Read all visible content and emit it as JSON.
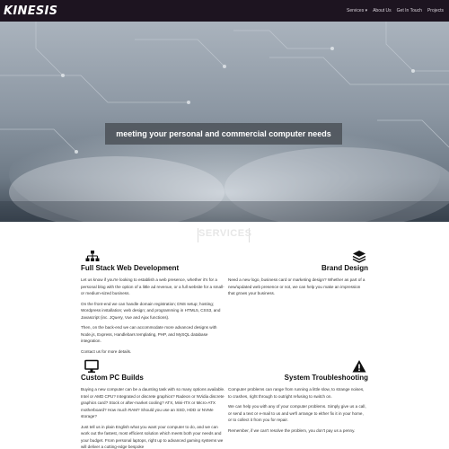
{
  "nav": {
    "brand": "KINESIS",
    "links": [
      "Services ▾",
      "About Us",
      "Get In Touch",
      "Projects"
    ]
  },
  "hero": {
    "caption": "meeting your personal and commercial computer needs"
  },
  "services": {
    "title": "SERVICES",
    "items": [
      {
        "icon": "sitemap-icon",
        "heading": "Full Stack Web Development",
        "paragraphs": [
          "Let us know if you're looking to establish a web presence, whether it's for a personal blog with the option of a little ad revenue, or a full website for a small- or medium-sized business.",
          "On the front-end we can handle domain registration; DNS setup; hosting; Wordpress installation; web design; and programming in HTML5, CSS3, and Javascript (inc. JQuery, Vue and Ajax functions).",
          "Then, on the back-end we can accommodate more advanced designs with Node.js, Express, Handlebars templating, PHP, and MySQL database integration.",
          "Contact us for more details."
        ]
      },
      {
        "icon": "layers-icon",
        "heading": "Brand Design",
        "paragraphs": [
          "Need a new logo, business card or marketing design? Whether as part of a new/updated web presence or not, we can help you make an impression that grows your business."
        ]
      },
      {
        "icon": "monitor-icon",
        "heading": "Custom PC Builds",
        "paragraphs": [
          "Buying a new computer can be a daunting task with so many options available. Intel or AMD CPU? Integrated or discrete graphics? Radeon or NVidia discrete graphics card? Stock or after-market cooling? ATX, Mini-ITX or Micro-ATX motherboard? How much RAM? Should you use an SSD, HDD or NVMe storage?",
          "Just tell us in plain English what you want your computer to do, and we can work out the fastest, most efficient solution which meets both your needs and your budget. From personal laptops, right up to advanced gaming systems we will deliver a cutting-edge bespoke"
        ]
      },
      {
        "icon": "warning-icon",
        "heading": "System Troubleshooting",
        "paragraphs": [
          "Computer problems can range from running a little slow, to strange noises, to crashes, right through to outright refusing to switch on.",
          "We can help you with any of your computer problems. Simply give us a call, or send a text or e-mail to us and we'll arrange to either fix it in your home, or to collect it from you for repair.",
          "Remember, if we can't resolve the problem, you don't pay us a penny."
        ]
      }
    ]
  }
}
